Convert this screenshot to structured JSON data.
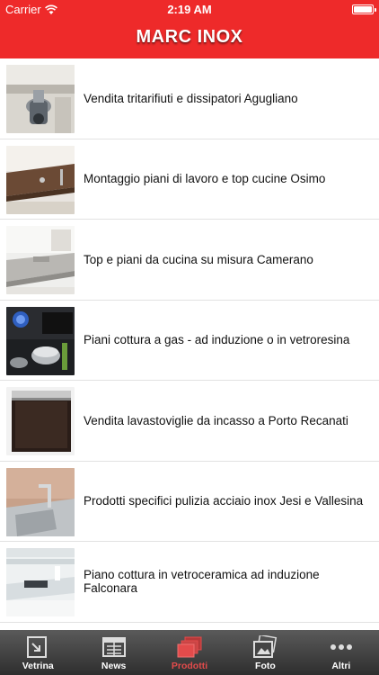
{
  "status_bar": {
    "carrier": "Carrier",
    "time": "2:19 AM"
  },
  "header": {
    "title": "MARC INOX"
  },
  "items": [
    {
      "label": "Vendita tritarifiuti e dissipatori Agugliano",
      "icon": "disposal-photo"
    },
    {
      "label": "Montaggio piani di lavoro e top cucine Osimo",
      "icon": "kitchen-counter-photo"
    },
    {
      "label": "Top e piani da cucina su misura Camerano",
      "icon": "kitchen-top-photo"
    },
    {
      "label": "Piani cottura a gas - ad induzione o in vetroresina",
      "icon": "stove-photo"
    },
    {
      "label": "Vendita lavastoviglie da incasso a Porto Recanati",
      "icon": "dishwasher-photo"
    },
    {
      "label": "Prodotti specifici pulizia acciaio inox Jesi e Vallesina",
      "icon": "steel-sink-photo"
    },
    {
      "label": "Piano cottura in vetroceramica ad induzione Falconara",
      "icon": "induction-kitchen-photo"
    }
  ],
  "tabs": [
    {
      "label": "Vetrina",
      "icon": "vetrina-icon",
      "active": false
    },
    {
      "label": "News",
      "icon": "news-icon",
      "active": false
    },
    {
      "label": "Prodotti",
      "icon": "prodotti-icon",
      "active": true
    },
    {
      "label": "Foto",
      "icon": "foto-icon",
      "active": false
    },
    {
      "label": "Altri",
      "icon": "more-icon",
      "active": false
    }
  ],
  "colors": {
    "header_bg": "#ee2a2a",
    "tab_active": "#e24b4b",
    "tab_bg": "#3a3a3a"
  }
}
